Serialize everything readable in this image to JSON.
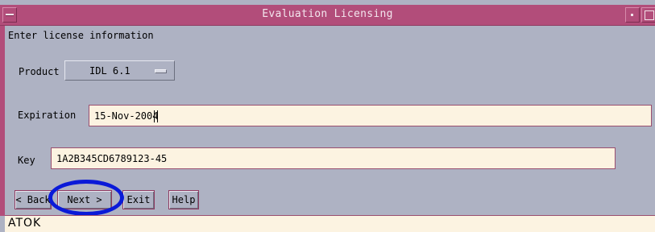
{
  "window": {
    "title": "Evaluation Licensing",
    "icons": {
      "menu": "window-menu-icon",
      "minimize": "minimize-icon",
      "maximize": "maximize-icon"
    },
    "colors": {
      "titlebar": "#b24d7a",
      "background": "#aeb2c3",
      "field": "#fcf3e1",
      "highlight": "#0a1ad8"
    }
  },
  "form": {
    "instruction": "Enter license information",
    "product": {
      "label": "Product",
      "value": "IDL 6.1"
    },
    "expiration": {
      "label": "Expiration",
      "value": "15-Nov-2004"
    },
    "key": {
      "label": "Key",
      "value": "1A2B345CD6789123-45"
    }
  },
  "buttons": {
    "back": "< Back",
    "next": "Next >",
    "exit": "Exit",
    "help": "Help"
  },
  "status": {
    "text": "ATOK"
  }
}
